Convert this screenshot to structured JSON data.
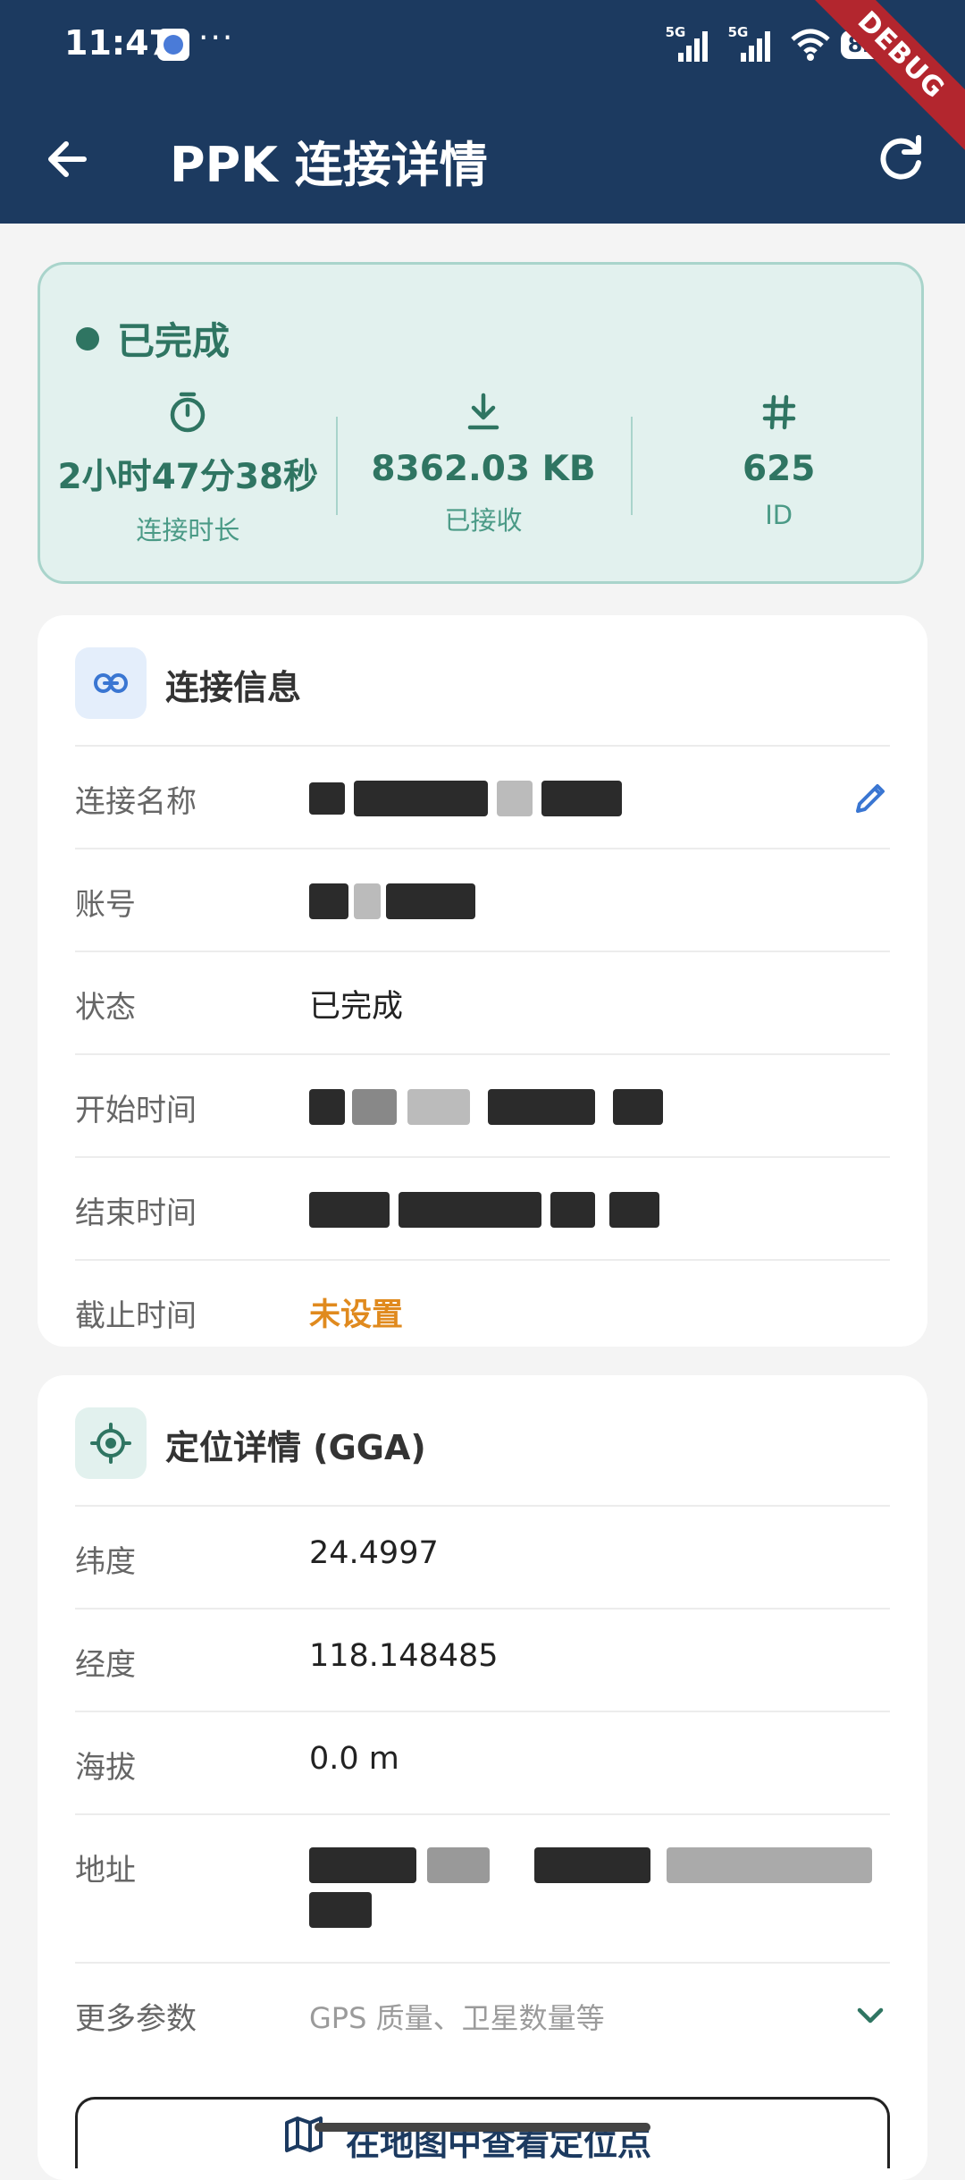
{
  "status_bar": {
    "time": "11:47",
    "dots": "···",
    "net1_tag": "5G",
    "net2_tag": "5G",
    "battery": "82",
    "debug_label": "DEBUG"
  },
  "app_bar": {
    "title": "PPK 连接详情",
    "back_icon": "arrow-left-icon",
    "refresh_icon": "refresh-icon"
  },
  "summary": {
    "status": "已完成",
    "stats": [
      {
        "icon": "timer-icon",
        "value": "2小时47分38秒",
        "label": "连接时长"
      },
      {
        "icon": "download-icon",
        "value": "8362.03 KB",
        "label": "已接收"
      },
      {
        "icon": "hash-icon",
        "value": "625",
        "label": "ID"
      }
    ],
    "accent_color": "#2f7562"
  },
  "connection_info": {
    "title": "连接信息",
    "rows": {
      "name_label": "连接名称",
      "account_label": "账号",
      "status_label": "状态",
      "status_value": "已完成",
      "start_label": "开始时间",
      "end_label": "结束时间",
      "deadline_label": "截止时间",
      "deadline_value": "未设置"
    }
  },
  "location": {
    "title": "定位详情 (GGA)",
    "rows": {
      "lat_label": "纬度",
      "lat_value": "24.4997",
      "lon_label": "经度",
      "lon_value": "118.148485",
      "alt_label": "海拔",
      "alt_value": "0.0 m",
      "addr_label": "地址",
      "more_label": "更多参数",
      "more_value": "GPS 质量、卫星数量等"
    }
  },
  "map_button": {
    "label": "在地图中查看定位点"
  }
}
